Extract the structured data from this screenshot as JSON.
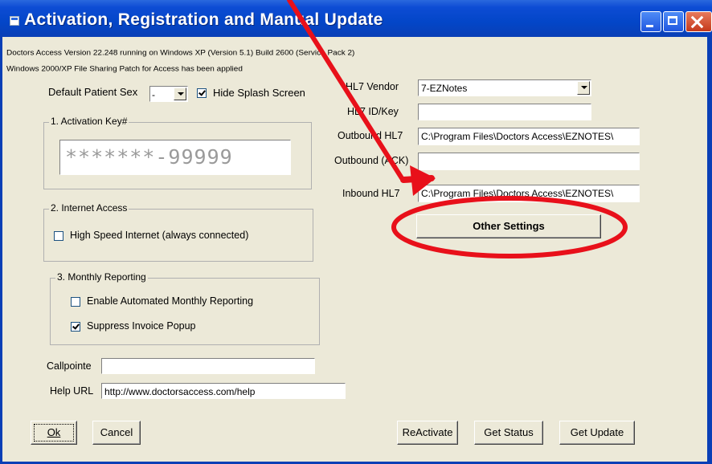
{
  "window": {
    "title": "Activation, Registration and Manual Update"
  },
  "info": {
    "line1": "Doctors Access Version 22.248 running on Windows XP (Version 5.1) Build 2600 (Service Pack 2)",
    "line2": "Windows 2000/XP File Sharing Patch for Access has been applied"
  },
  "patient": {
    "sex_label": "Default Patient Sex",
    "sex_value": "-"
  },
  "splash": {
    "label": "Hide Splash Screen",
    "checked": true
  },
  "activation": {
    "legend": "1. Activation Key#",
    "value": "*******-99999"
  },
  "internet": {
    "legend": "2. Internet Access",
    "label": "High Speed Internet (always connected)",
    "checked": false
  },
  "reporting": {
    "legend": "3. Monthly Reporting",
    "enable_label": "Enable Automated Monthly Reporting",
    "enable_checked": false,
    "suppress_label": "Suppress Invoice Popup",
    "suppress_checked": true
  },
  "callpointe": {
    "label": "Callpointe",
    "value": ""
  },
  "help": {
    "label": "Help URL",
    "value": "http://www.doctorsaccess.com/help"
  },
  "hl7": {
    "vendor_label": "HL7 Vendor",
    "vendor_value": "7-EZNotes",
    "id_label": "HL7 ID/Key",
    "id_value": "",
    "outbound_label": "Outbound HL7",
    "outbound_value": "C:\\Program Files\\Doctors Access\\EZNOTES\\",
    "ack_label": "Outbound (ACK)",
    "ack_value": "",
    "inbound_label": "Inbound HL7",
    "inbound_value": "C:\\Program Files\\Doctors Access\\EZNOTES\\"
  },
  "buttons": {
    "other_settings": "Other Settings",
    "ok": "Ok",
    "cancel": "Cancel",
    "reactivate": "ReActivate",
    "get_status": "Get Status",
    "get_update": "Get Update"
  },
  "colors": {
    "titlebar": "#0346c8",
    "annotation": "#e8101a",
    "dialog_bg": "#ece9d8"
  }
}
